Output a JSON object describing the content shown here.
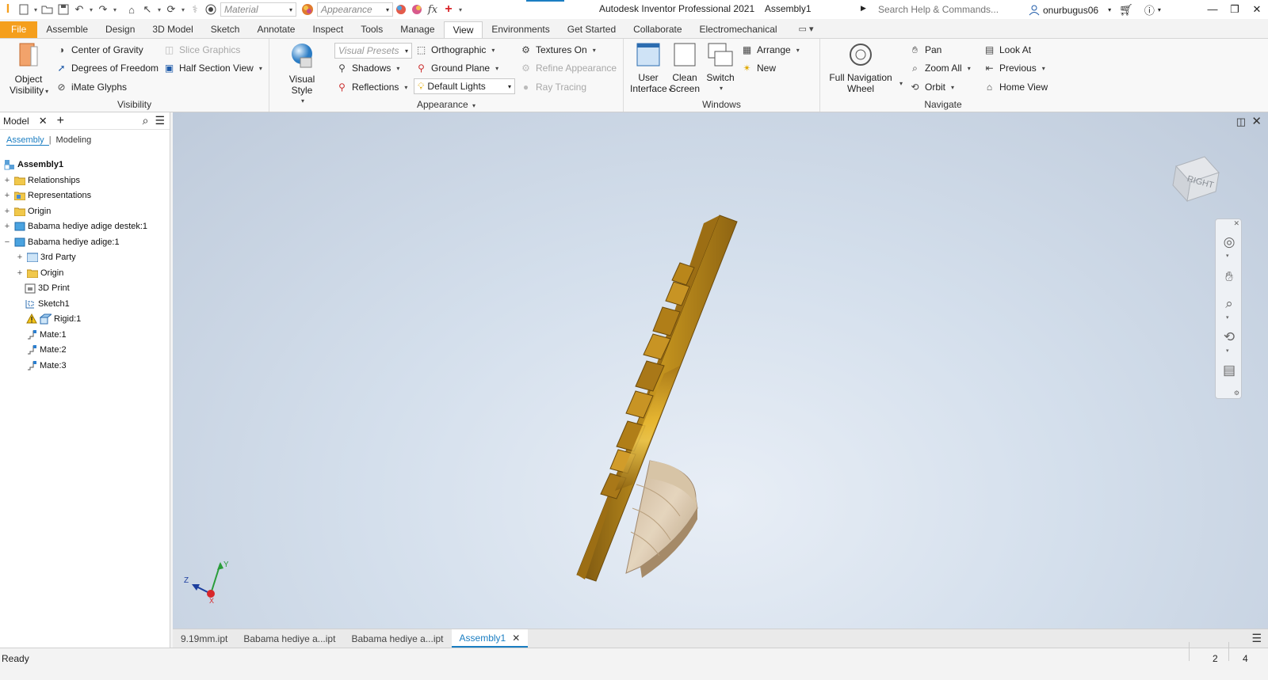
{
  "app": {
    "title": "Autodesk Inventor Professional 2021",
    "document": "Assembly1",
    "search_placeholder": "Search Help & Commands...",
    "user": "onurbugus06"
  },
  "quick_access": {
    "material_placeholder": "Material",
    "appearance_placeholder": "Appearance",
    "fx_label": "fx"
  },
  "tabs": [
    "File",
    "Assemble",
    "Design",
    "3D Model",
    "Sketch",
    "Annotate",
    "Inspect",
    "Tools",
    "Manage",
    "View",
    "Environments",
    "Get Started",
    "Collaborate",
    "Electromechanical"
  ],
  "active_tab": "View",
  "ribbon": {
    "visibility": {
      "title": "Visibility",
      "object_visibility_line1": "Object",
      "object_visibility_line2": "Visibility",
      "center_of_gravity": "Center of Gravity",
      "degrees_of_freedom": "Degrees of Freedom",
      "imate_glyphs": "iMate Glyphs",
      "slice_graphics": "Slice Graphics",
      "half_section_view": "Half Section View"
    },
    "appearance": {
      "title": "Appearance",
      "visual_style": "Visual Style",
      "visual_presets": "Visual Presets",
      "shadows": "Shadows",
      "reflections": "Reflections",
      "orthographic": "Orthographic",
      "ground_plane": "Ground Plane",
      "default_lights": "Default Lights",
      "textures_on": "Textures On",
      "refine_appearance": "Refine Appearance",
      "ray_tracing": "Ray Tracing"
    },
    "windows": {
      "title": "Windows",
      "user_interface_line1": "User",
      "user_interface_line2": "Interface",
      "clean_screen_line1": "Clean",
      "clean_screen_line2": "Screen",
      "switch": "Switch",
      "arrange": "Arrange",
      "new": "New"
    },
    "navigate": {
      "title": "Navigate",
      "full_nav_wheel_line1": "Full Navigation",
      "full_nav_wheel_line2": "Wheel",
      "pan": "Pan",
      "zoom_all": "Zoom All",
      "orbit": "Orbit",
      "look_at": "Look At",
      "previous": "Previous",
      "home_view": "Home View"
    }
  },
  "browser": {
    "title": "Model",
    "subtabs": [
      "Assembly",
      "Modeling"
    ],
    "tree": [
      {
        "label": "Assembly1",
        "bold": true
      },
      {
        "label": "Relationships"
      },
      {
        "label": "Representations"
      },
      {
        "label": "Origin"
      },
      {
        "label": "Babama hediye adige destek:1"
      },
      {
        "label": "Babama hediye adige:1"
      },
      {
        "label": "3rd Party"
      },
      {
        "label": "Origin"
      },
      {
        "label": "3D Print"
      },
      {
        "label": "Sketch1"
      },
      {
        "label": "Rigid:1"
      },
      {
        "label": "Mate:1"
      },
      {
        "label": "Mate:2"
      },
      {
        "label": "Mate:3"
      }
    ]
  },
  "viewport": {
    "viewcube_label": "RIGHT",
    "axis_labels": {
      "x": "X",
      "y": "Y",
      "z": "Z"
    },
    "colors": {
      "brass": "#b8891f",
      "wood": "#d9c4a8"
    }
  },
  "doc_tabs": [
    "9.19mm.ipt",
    "Babama hediye a...ipt",
    "Babama hediye a...ipt",
    "Assembly1"
  ],
  "active_doc_tab": "Assembly1",
  "status": {
    "text": "Ready",
    "count1": "2",
    "count2": "4"
  }
}
